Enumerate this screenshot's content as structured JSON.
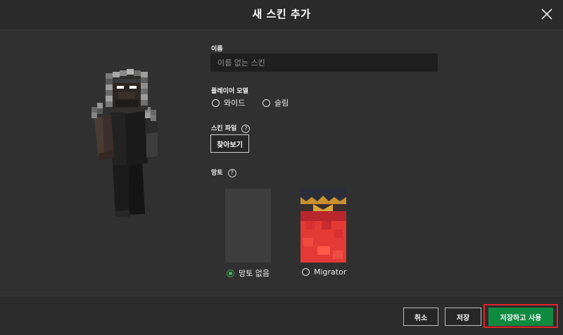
{
  "dialog": {
    "title": "새 스킨 추가"
  },
  "form": {
    "name_label": "이름",
    "name_placeholder": "이름 없는 스킨",
    "name_value": "",
    "player_model_label": "플레이어 모델",
    "model_options": [
      {
        "label": "와이드",
        "selected": false
      },
      {
        "label": "슬림",
        "selected": false
      }
    ],
    "skin_file_label": "스킨 파일",
    "browse_label": "찾아보기",
    "cape_label": "망토",
    "cape_options": [
      {
        "label": "망토 없음",
        "selected": true
      },
      {
        "label": "Migrator",
        "selected": false
      }
    ]
  },
  "footer": {
    "cancel_label": "취소",
    "save_label": "저장",
    "save_and_use_label": "저장하고 사용"
  },
  "help_glyph": "?",
  "colors": {
    "accent": "#0f8a3f",
    "highlight": "#e0242b",
    "radio_selected": "#3fbe63"
  }
}
